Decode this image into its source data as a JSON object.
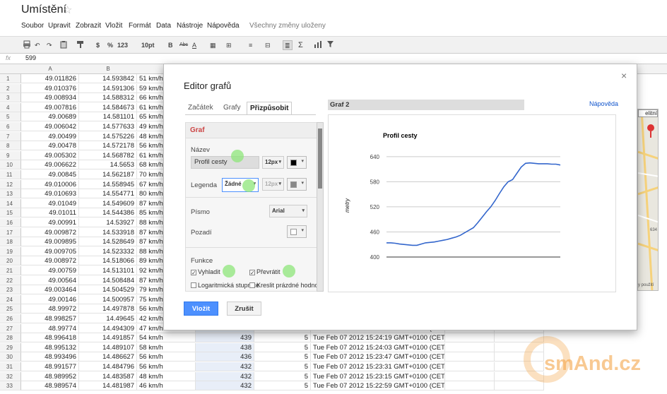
{
  "doc": {
    "title": "Umístění",
    "star": "☆"
  },
  "menu": {
    "items": [
      "Soubor",
      "Upravit",
      "Zobrazit",
      "Vložit",
      "Formát",
      "Data",
      "Nástroje",
      "Nápověda"
    ],
    "saved": "Všechny změny uloženy"
  },
  "toolbar": {
    "currency": "$",
    "percent": "%",
    "number": "123",
    "font_size": "10pt",
    "bold": "B",
    "strike": "Abc",
    "text_color": "A",
    "sigma": "Σ"
  },
  "formula": {
    "fx": "fx",
    "value": "599"
  },
  "columns": {
    "a": "A",
    "b": "B"
  },
  "rows": [
    {
      "n": "1",
      "a": "49.011826",
      "b": "14.593842",
      "c": "51 km/h"
    },
    {
      "n": "2",
      "a": "49.010376",
      "b": "14.591306",
      "c": "59 km/h"
    },
    {
      "n": "3",
      "a": "49.008934",
      "b": "14.588312",
      "c": "66 km/h"
    },
    {
      "n": "4",
      "a": "49.007816",
      "b": "14.584673",
      "c": "61 km/h"
    },
    {
      "n": "5",
      "a": "49.00689",
      "b": "14.581101",
      "c": "65 km/h"
    },
    {
      "n": "6",
      "a": "49.006042",
      "b": "14.577633",
      "c": "49 km/h"
    },
    {
      "n": "7",
      "a": "49.00499",
      "b": "14.575226",
      "c": "48 km/h"
    },
    {
      "n": "8",
      "a": "49.00478",
      "b": "14.572178",
      "c": "56 km/h"
    },
    {
      "n": "9",
      "a": "49.005302",
      "b": "14.568782",
      "c": "61 km/h"
    },
    {
      "n": "10",
      "a": "49.006622",
      "b": "14.5653",
      "c": "68 km/h"
    },
    {
      "n": "11",
      "a": "49.00845",
      "b": "14.562187",
      "c": "70 km/h"
    },
    {
      "n": "12",
      "a": "49.010006",
      "b": "14.558945",
      "c": "67 km/h"
    },
    {
      "n": "13",
      "a": "49.010693",
      "b": "14.554771",
      "c": "80 km/h"
    },
    {
      "n": "14",
      "a": "49.01049",
      "b": "14.549609",
      "c": "87 km/h"
    },
    {
      "n": "15",
      "a": "49.01011",
      "b": "14.544386",
      "c": "85 km/h"
    },
    {
      "n": "16",
      "a": "49.00991",
      "b": "14.53927",
      "c": "88 km/h"
    },
    {
      "n": "17",
      "a": "49.009872",
      "b": "14.533918",
      "c": "87 km/h"
    },
    {
      "n": "18",
      "a": "49.009895",
      "b": "14.528649",
      "c": "87 km/h"
    },
    {
      "n": "19",
      "a": "49.009705",
      "b": "14.523332",
      "c": "88 km/h"
    },
    {
      "n": "20",
      "a": "49.008972",
      "b": "14.518066",
      "c": "89 km/h"
    },
    {
      "n": "21",
      "a": "49.00759",
      "b": "14.513101",
      "c": "92 km/h"
    },
    {
      "n": "22",
      "a": "49.00564",
      "b": "14.508484",
      "c": "87 km/h"
    },
    {
      "n": "23",
      "a": "49.003464",
      "b": "14.504529",
      "c": "79 km/h"
    },
    {
      "n": "24",
      "a": "49.00146",
      "b": "14.500957",
      "c": "75 km/h"
    },
    {
      "n": "25",
      "a": "48.99972",
      "b": "14.497878",
      "c": "56 km/h"
    },
    {
      "n": "26",
      "a": "48.998257",
      "b": "14.49645",
      "c": "42 km/h"
    },
    {
      "n": "27",
      "a": "48.99774",
      "b": "14.494309",
      "c": "47 km/h",
      "e": "446",
      "f": "5",
      "g": "Tue Feb 07 2012 15:24:35 GMT+0100 (CET)"
    },
    {
      "n": "28",
      "a": "48.996418",
      "b": "14.491857",
      "c": "54 km/h",
      "e": "439",
      "f": "5",
      "g": "Tue Feb 07 2012 15:24:19 GMT+0100 (CET)"
    },
    {
      "n": "29",
      "a": "48.995132",
      "b": "14.489107",
      "c": "58 km/h",
      "e": "438",
      "f": "5",
      "g": "Tue Feb 07 2012 15:24:03 GMT+0100 (CET)"
    },
    {
      "n": "30",
      "a": "48.993496",
      "b": "14.486627",
      "c": "56 km/h",
      "e": "436",
      "f": "5",
      "g": "Tue Feb 07 2012 15:23:47 GMT+0100 (CET)"
    },
    {
      "n": "31",
      "a": "48.991577",
      "b": "14.484796",
      "c": "56 km/h",
      "e": "432",
      "f": "5",
      "g": "Tue Feb 07 2012 15:23:31 GMT+0100 (CET)"
    },
    {
      "n": "32",
      "a": "48.989952",
      "b": "14.483587",
      "c": "48 km/h",
      "e": "432",
      "f": "5",
      "g": "Tue Feb 07 2012 15:23:15 GMT+0100 (CET)"
    },
    {
      "n": "33",
      "a": "48.989574",
      "b": "14.481987",
      "c": "46 km/h",
      "e": "432",
      "f": "5",
      "g": "Tue Feb 07 2012 15:22:59 GMT+0100 (CET)"
    }
  ],
  "editor": {
    "title": "Editor grafů",
    "close": "×",
    "tabs": [
      "Začátek",
      "Grafy",
      "Přizpůsobit"
    ],
    "section": "Graf",
    "name_label": "Název",
    "name_value": "Profil cesty",
    "size_12": "12px",
    "legend_label": "Legenda",
    "legend_value": "Žádné",
    "font_label": "Písmo",
    "font_value": "Arial",
    "bg_label": "Pozadí",
    "func_label": "Funkce",
    "smooth": "Vyhladit",
    "reverse": "Převrátit",
    "log": "Logaritmická stupnice",
    "empty": "Kreslit prázdné hodnoty",
    "chart_name": "Graf 2",
    "help": "Nápověda",
    "insert": "Vložit",
    "cancel": "Zrušit"
  },
  "map": {
    "label_top": "elitní",
    "label_mid": "634",
    "label_bot": "y použití"
  },
  "watermark": {
    "text": "smAnd.cz"
  },
  "chart_data": {
    "type": "line",
    "title": "Profil cesty",
    "ylabel": "metry",
    "xlabel": "",
    "ylim": [
      400,
      660
    ],
    "yticks": [
      400,
      460,
      520,
      580,
      640
    ],
    "grid": true,
    "legend": "none",
    "color": "#3366cc",
    "series": [
      {
        "values": [
          434,
          434,
          433,
          431,
          430,
          429,
          428,
          428,
          431,
          434,
          435,
          436,
          438,
          440,
          442,
          445,
          448,
          452,
          458,
          464,
          470,
          482,
          495,
          508,
          520,
          535,
          552,
          568,
          580,
          585,
          600,
          615,
          624,
          625,
          624,
          623,
          623,
          623,
          622,
          622,
          620
        ]
      }
    ]
  }
}
